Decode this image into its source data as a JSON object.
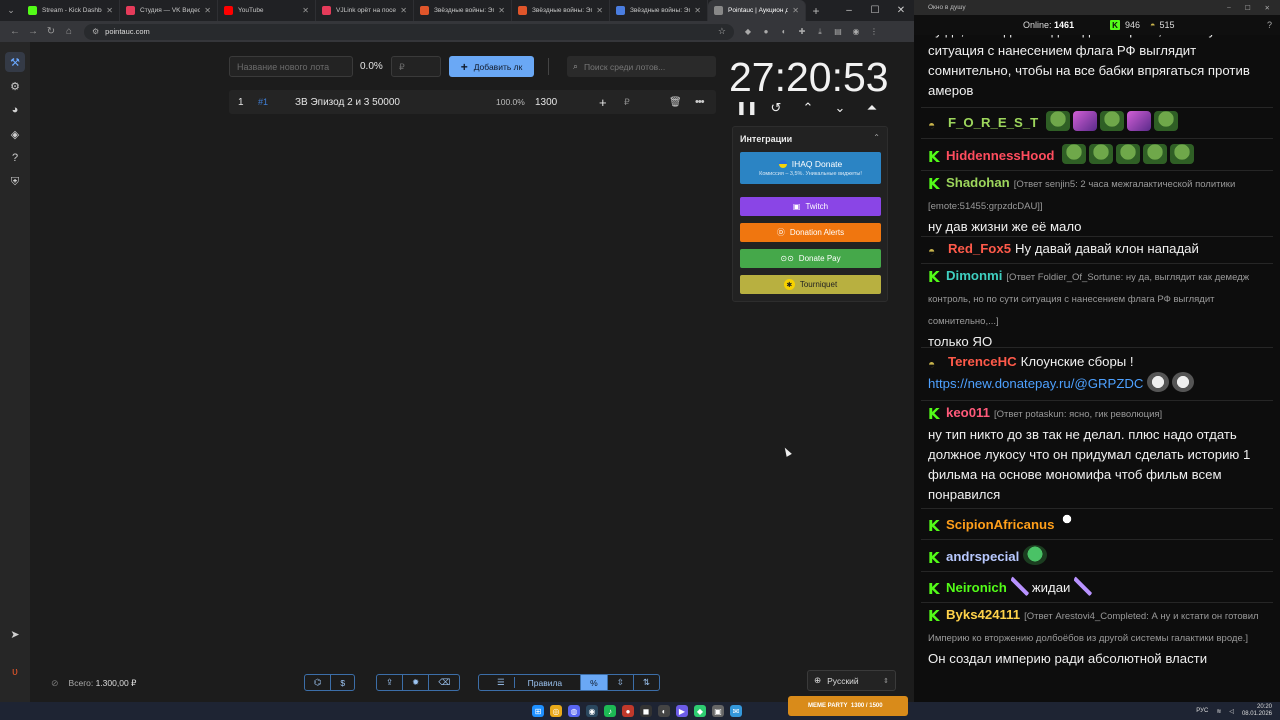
{
  "browser": {
    "tabs": [
      {
        "label": "Stream - Kick Dashboard",
        "color": "#53fc18"
      },
      {
        "label": "Студия — VK Видео Li...",
        "color": "#e53b5a"
      },
      {
        "label": "YouTube",
        "color": "#ff0000"
      },
      {
        "label": "VJLink орёт на посетит...",
        "color": "#e53b5a"
      },
      {
        "label": "Звёздные войны: Эпиз...",
        "color": "#e0552a"
      },
      {
        "label": "Звёздные войны: Эпиз...",
        "color": "#e0552a"
      },
      {
        "label": "Звёздные войны: Эпиз...",
        "color": "#4a7de0"
      },
      {
        "label": "Pointauc | Аукцион для...",
        "color": "#888888"
      }
    ],
    "url": "pointauc.com"
  },
  "toolbar": {
    "lot_name_placeholder": "Название нового лота",
    "percent": "0.0%",
    "amount_placeholder": "₽",
    "add_button": "Добавить лк",
    "search_placeholder": "Поиск среди лотов..."
  },
  "lots": [
    {
      "index": "1",
      "fast_id": "#1",
      "name": "ЗВ Эпизод 2 и 3 50000",
      "percent": "100.0%",
      "amount": "1300",
      "currency": "₽"
    }
  ],
  "timer": {
    "time": "27:20:53"
  },
  "integrations": {
    "title": "Интеграции",
    "ihaq": {
      "label": "IHAQ Donate",
      "sublabel": "Комиссия – 3,5%. Уникальные виджеты!"
    },
    "twitch": "Twitch",
    "donation_alerts": "Donation Alerts",
    "donate_pay": "Donate Pay",
    "tourniquet": "Tourniquet"
  },
  "footer": {
    "total_label": "Всего:",
    "total_value": "1.300,00 ₽",
    "rules_label": "Правила",
    "language": "Русский"
  },
  "chat_window": {
    "title": "Окно в душу",
    "online_label": "Online:",
    "online_count": "1461",
    "kick_count": "946",
    "other_count": "515"
  },
  "chat": {
    "messages": [
      {
        "platform": "none",
        "nick": "",
        "nick_color": "#ffffff",
        "reply": "",
        "text": "ну да, выглядит как демедж контроль, но по сути ситуация с нанесением флага РФ выглядит сомнительно, чтобы на все бабки впрягаться против амеров"
      },
      {
        "platform": "twitch",
        "nick": "F_O_R_E_S_T",
        "nick_color": "#9dd65c",
        "reply": "",
        "text": ""
      },
      {
        "platform": "kick",
        "nick": "HiddennessHood",
        "nick_color": "#ff4d5e",
        "reply": "",
        "text": ""
      },
      {
        "platform": "kick",
        "nick": "Shadohan",
        "nick_color": "#9dd65c",
        "reply": "[Ответ senjin5: 2 часа межгалактической политики [emote:51455:grpzdcDAU]]",
        "text": "ну дав жизни же её мало"
      },
      {
        "platform": "twitch",
        "nick": "Red_Fox5",
        "nick_color": "#ff5a4a",
        "reply": "",
        "text": "Ну давай давай клон нападай"
      },
      {
        "platform": "kick",
        "nick": "Dimonmi",
        "nick_color": "#3fcfc0",
        "reply": "[Ответ Foldier_Of_Sortune: ну да, выглядит как демедж контроль, но по сути ситуация с нанесением флага РФ выглядит сомнительно,...]",
        "text": "только ЯО"
      },
      {
        "platform": "twitch",
        "nick": "TerenceHC",
        "nick_color": "#ff5a4a",
        "reply": "",
        "text": "Клоунские сборы !",
        "link": "https://new.donatepay.ru/@GRPZDC"
      },
      {
        "platform": "kick",
        "nick": "keo011",
        "nick_color": "#ff5a7a",
        "reply": "[Ответ potaskun: ясно, гик революция]",
        "text": "ну тип никто до зв так не делал. плюс надо отдать должное лукосу что он придумал сделать историю 1 фильма на основе мономифа чтоб фильм всем понравился"
      },
      {
        "platform": "kick",
        "nick": "ScipionAfricanus",
        "nick_color": "#ff9f1a",
        "reply": "",
        "text": ""
      },
      {
        "platform": "kick",
        "nick": "andrspecial",
        "nick_color": "#b8c9ff",
        "reply": "",
        "text": ""
      },
      {
        "platform": "kick",
        "nick": "Neironich",
        "nick_color": "#53fc18",
        "reply": "",
        "text": "жидаи"
      },
      {
        "platform": "kick",
        "nick": "Byks424111",
        "nick_color": "#ffd24a",
        "reply": "[Ответ Arestovi4_Completed: А ну и кстати он готовил Империю ко вторжению долбоёбов из другой системы галактики вроде.]",
        "text": "Он создал империю ради абсолютной власти"
      }
    ]
  },
  "taskbar": {
    "banner": "MEME PARTY",
    "banner_count": "1300 / 1500",
    "lang": "РУС",
    "time": "20:20",
    "date": "08.01.2026"
  }
}
